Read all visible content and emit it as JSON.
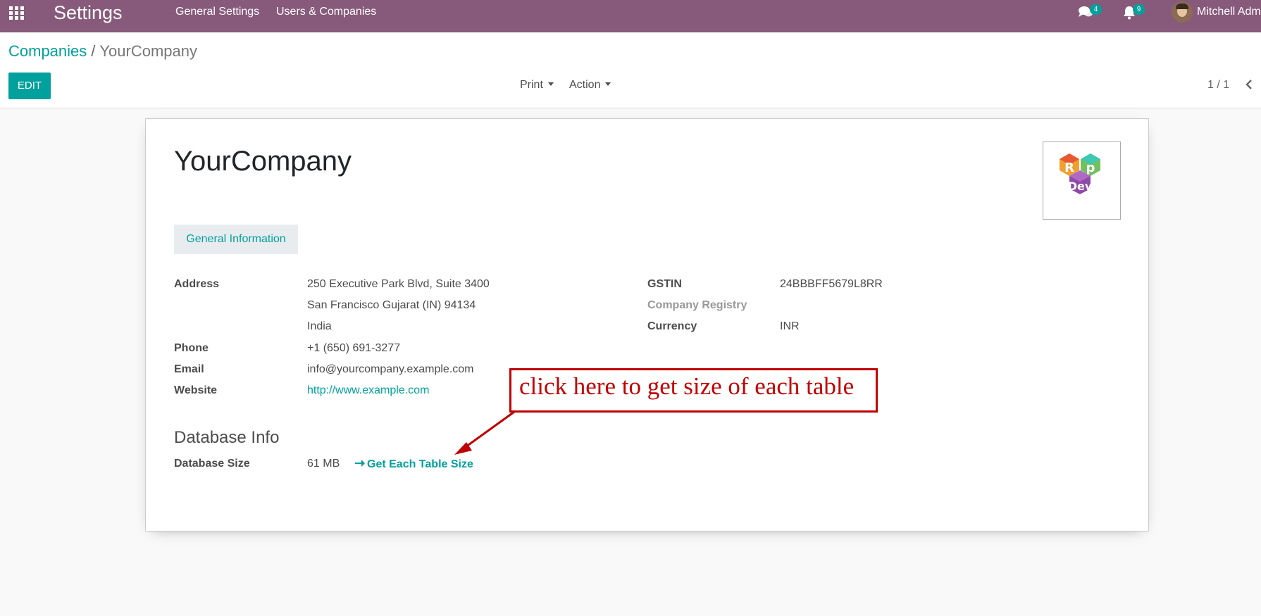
{
  "navbar": {
    "app_title": "Settings",
    "menus": [
      "General Settings",
      "Users & Companies"
    ],
    "messages_count": "4",
    "notifications_count": "9",
    "user_name": "Mitchell Adm"
  },
  "control_panel": {
    "breadcrumb_parent": "Companies",
    "breadcrumb_separator": "/",
    "breadcrumb_current": "YourCompany",
    "edit_label": "EDIT",
    "print_label": "Print",
    "action_label": "Action",
    "pager": "1 / 1"
  },
  "form": {
    "company_name": "YourCompany",
    "logo": {
      "letters": [
        "R",
        "p",
        "Dev"
      ]
    },
    "tab_label": "General Information",
    "left_fields": {
      "address_label": "Address",
      "address_lines": [
        "250 Executive Park Blvd, Suite 3400",
        "San Francisco  Gujarat (IN)  94134",
        "India"
      ],
      "phone_label": "Phone",
      "phone": "+1 (650) 691-3277",
      "email_label": "Email",
      "email": "info@yourcompany.example.com",
      "website_label": "Website",
      "website": "http://www.example.com"
    },
    "right_fields": {
      "gstin_label": "GSTIN",
      "gstin": "24BBBFF5679L8RR",
      "registry_label": "Company Registry",
      "currency_label": "Currency",
      "currency": "INR"
    },
    "database_info": {
      "section_title": "Database Info",
      "size_label": "Database Size",
      "size_value": "61 MB",
      "table_size_button": "Get Each Table Size"
    }
  },
  "annotation": {
    "text": "click here to get size of each table"
  },
  "colors": {
    "navbar": "#875a7b",
    "primary": "#00a09d",
    "annotation": "#c00000"
  }
}
